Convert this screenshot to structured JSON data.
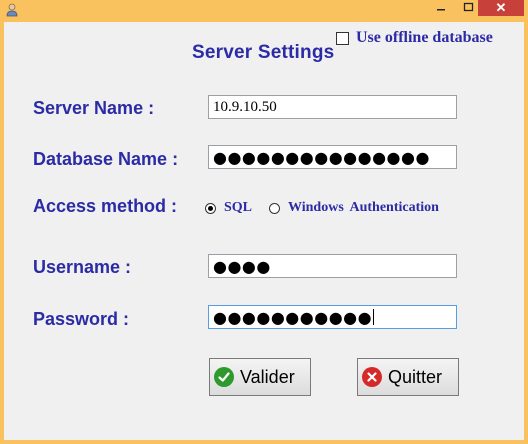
{
  "window": {
    "close_glyph": "✕"
  },
  "form": {
    "title": "Server Settings",
    "offline_label": "Use offline database",
    "server_name_label": "Server Name :",
    "server_name_value": "10.9.10.50",
    "database_name_label": "Database Name :",
    "database_name_masked": "●●●●●●●●●●●●●●●",
    "access_method_label": "Access method :",
    "access_sql_label": "SQL",
    "access_windows_label": "Windows  Authentication",
    "username_label": "Username :",
    "username_masked": "●●●●",
    "password_label": "Password :",
    "password_masked": "●●●●●●●●●●●",
    "validate_label": "Valider",
    "quit_label": "Quitter"
  },
  "icons": {
    "app": "person-icon",
    "minimize": "minimize-icon",
    "maximize": "maximize-icon",
    "close": "close-icon",
    "validate": "check-icon",
    "quit": "x-circle-icon"
  },
  "colors": {
    "title_bar": "#f9c25e",
    "label_text": "#2c2ba6",
    "close_button": "#c7403a",
    "check_icon": "#2e9a2e",
    "quit_icon": "#d62a2a"
  },
  "state": {
    "offline_checked": false,
    "access_selected": "SQL"
  }
}
